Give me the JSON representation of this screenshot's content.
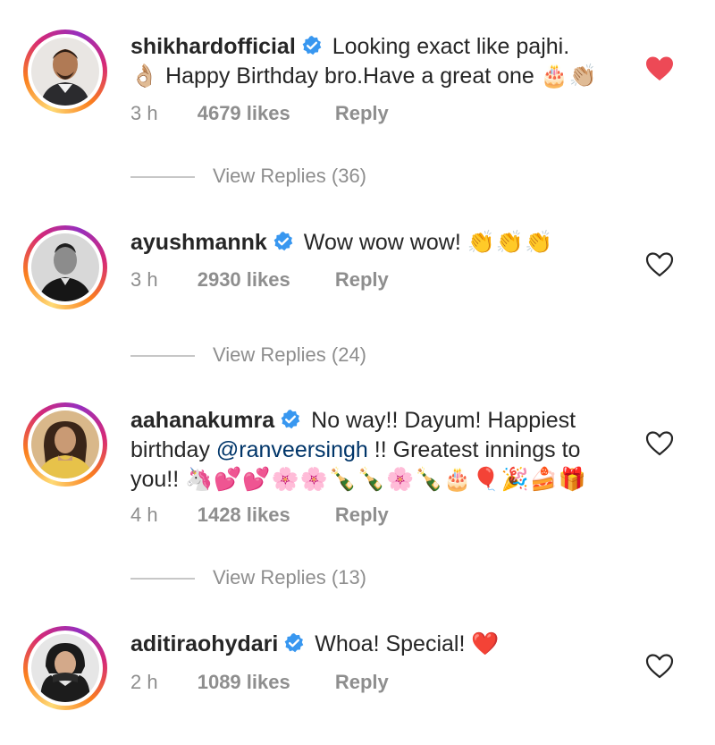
{
  "colors": {
    "accent_red": "#ed4956",
    "meta_gray": "#8e8e8e",
    "verified_blue": "#3897f0",
    "mention": "#003569"
  },
  "comments": [
    {
      "username": "shikhardofficial",
      "text": "Looking exact like pajhi.",
      "text_line2_emoji": "👌🏼",
      "text_line2": "Happy Birthday bro.Have a great one",
      "text_end_emoji": "🎂👏🏼",
      "time": "3 h",
      "likes": "4679 likes",
      "reply": "Reply",
      "liked": true,
      "heart_icon": "heart-filled-icon",
      "view_replies": "View Replies (36)"
    },
    {
      "username": "ayushmannk",
      "text": "Wow wow wow!",
      "text_end_emoji": "👏👏👏",
      "time": "3 h",
      "likes": "2930 likes",
      "reply": "Reply",
      "liked": false,
      "heart_icon": "heart-outline-icon",
      "view_replies": "View Replies (24)"
    },
    {
      "username": "aahanakumra",
      "text": "No way!! Dayum! Happiest",
      "text_line2_pre": "birthday",
      "mention": "@ranveersingh",
      "text_line2_post": "!! Greatest innings to",
      "text_line3": "you!!",
      "text_line3_emoji": "🦄💕💕🌸🌸🍾🍾🌸🍾🎂🎈🎉🍰🎁",
      "time": "4 h",
      "likes": "1428 likes",
      "reply": "Reply",
      "liked": false,
      "heart_icon": "heart-outline-icon",
      "view_replies": "View Replies (13)"
    },
    {
      "username": "aditiraohydari",
      "text": "Whoa! Special!",
      "text_end_emoji": "❤️",
      "time": "2 h",
      "likes": "1089 likes",
      "reply": "Reply",
      "liked": false,
      "heart_icon": "heart-outline-icon"
    }
  ]
}
